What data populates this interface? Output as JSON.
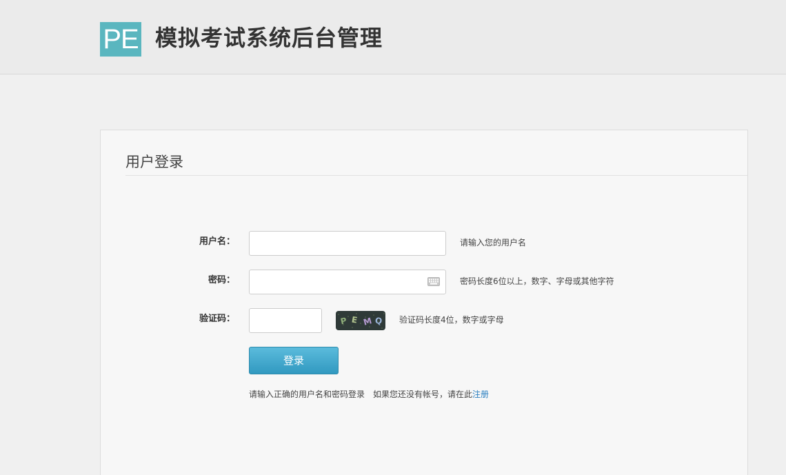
{
  "header": {
    "logo_text": "PE",
    "title": "模拟考试系统后台管理",
    "logo_color": "#5ab6bf"
  },
  "login": {
    "heading": "用户登录",
    "username": {
      "label": "用户名：",
      "value": "",
      "hint": "请输入您的用户名"
    },
    "password": {
      "label": "密码：",
      "value": "",
      "hint": "密码长度6位以上，数字、字母或其他字符",
      "icon": "keyboard-icon"
    },
    "captcha": {
      "label": "验证码：",
      "value": "",
      "image_text": "PEMQ",
      "hint": "验证码长度4位，数字或字母"
    },
    "submit_label": "登录",
    "note_text": "请输入正确的用户名和密码登录",
    "register_prompt": "如果您还没有帐号，请在此",
    "register_link": "注册",
    "accent_color": "#3199c0",
    "link_color": "#2a7fc0"
  }
}
